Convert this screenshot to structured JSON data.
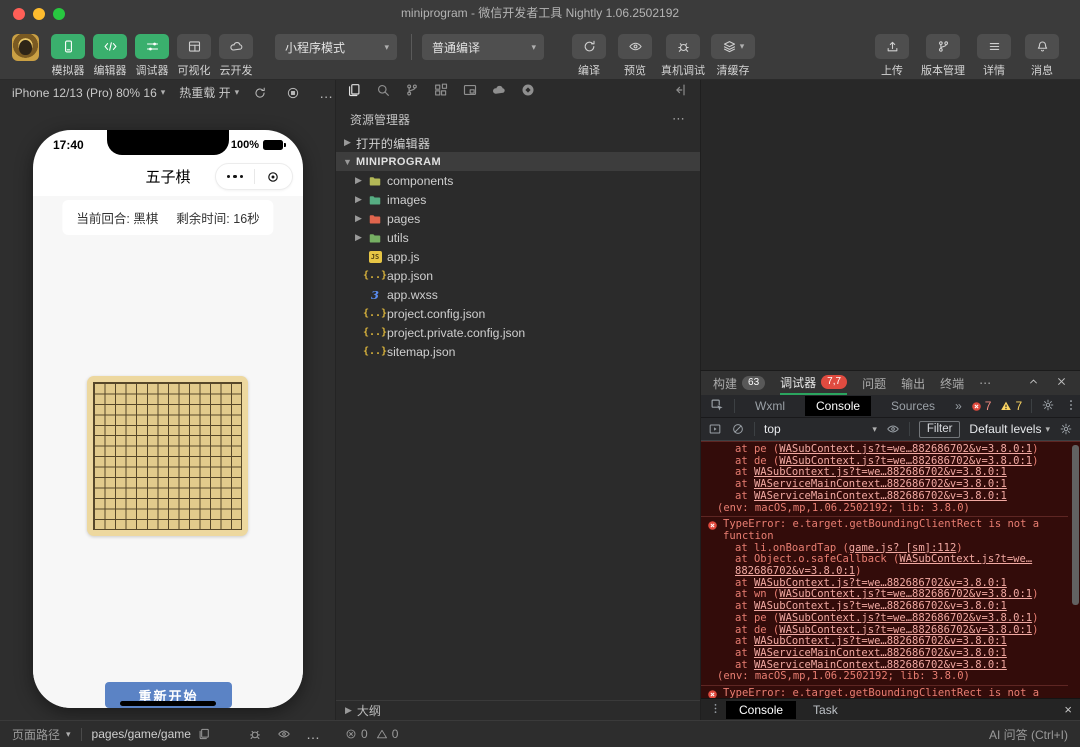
{
  "window": {
    "title": "miniprogram - 微信开发者工具 Nightly 1.06.2502192"
  },
  "toolbar": {
    "mode_dropdown": "小程序模式",
    "compile_dropdown": "普通编译",
    "mode_buttons": [
      {
        "name": "simulator",
        "label": "模拟器",
        "icon": "phone-icon",
        "active": true
      },
      {
        "name": "editor",
        "label": "编辑器",
        "icon": "code-icon",
        "active": true
      },
      {
        "name": "debugger",
        "label": "调试器",
        "icon": "sliders-icon",
        "active": true
      },
      {
        "name": "visualize",
        "label": "可视化",
        "icon": "layout-icon",
        "active": false
      },
      {
        "name": "cloud-dev",
        "label": "云开发",
        "icon": "cloud-icon",
        "active": false
      }
    ],
    "action_buttons": [
      {
        "name": "compile",
        "label": "编译",
        "icon": "refresh-icon"
      },
      {
        "name": "preview",
        "label": "预览",
        "icon": "eye-icon"
      },
      {
        "name": "device-debug",
        "label": "真机调试",
        "icon": "bug-icon"
      },
      {
        "name": "clear-cache",
        "label": "清缓存",
        "icon": "layers-icon",
        "caret": true
      }
    ],
    "right_buttons": [
      {
        "name": "upload",
        "label": "上传",
        "icon": "upload-icon"
      },
      {
        "name": "version-control",
        "label": "版本管理",
        "icon": "branch-icon"
      },
      {
        "name": "details",
        "label": "详情",
        "icon": "list-icon"
      },
      {
        "name": "messages",
        "label": "消息",
        "icon": "bell-icon"
      }
    ]
  },
  "simulator": {
    "device_selector": "iPhone 12/13 (Pro) 80% 16",
    "hot_reload": "热重载 开",
    "page_path_label": "页面路径",
    "page_path": "pages/game/game",
    "phone": {
      "time": "17:40",
      "battery": "100%",
      "nav_title": "五子棋",
      "turn_text": "当前回合: 黑棋",
      "time_text": "剩余时间: 16秒",
      "restart_label": "重新开始"
    }
  },
  "explorer": {
    "header": "资源管理器",
    "outline_label": "大纲",
    "tree": [
      {
        "name": "open-editors",
        "label": "打开的编辑器",
        "kind": "section",
        "expanded": false
      },
      {
        "name": "miniprogram-root",
        "label": "MINIPROGRAM",
        "kind": "section",
        "expanded": true,
        "selected": true
      },
      {
        "name": "components",
        "label": "components",
        "kind": "folder",
        "color": "#b3b857"
      },
      {
        "name": "images",
        "label": "images",
        "kind": "folder",
        "color": "#56ad82"
      },
      {
        "name": "pages",
        "label": "pages",
        "kind": "folder",
        "color": "#e0654d"
      },
      {
        "name": "utils",
        "label": "utils",
        "kind": "folder",
        "color": "#76b063"
      },
      {
        "name": "app-js",
        "label": "app.js",
        "kind": "js"
      },
      {
        "name": "app-json",
        "label": "app.json",
        "kind": "json"
      },
      {
        "name": "app-wxss",
        "label": "app.wxss",
        "kind": "wxss"
      },
      {
        "name": "project-config-json",
        "label": "project.config.json",
        "kind": "json"
      },
      {
        "name": "project-private-config-json",
        "label": "project.private.config.json",
        "kind": "json"
      },
      {
        "name": "sitemap-json",
        "label": "sitemap.json",
        "kind": "json"
      }
    ]
  },
  "debugger": {
    "section_tabs": [
      {
        "name": "build",
        "label": "构建",
        "badge": "63",
        "badge_color": "gray"
      },
      {
        "name": "debugger",
        "label": "调试器",
        "badge": "7,7",
        "badge_color": "red",
        "active": true
      },
      {
        "name": "problems",
        "label": "问题"
      },
      {
        "name": "output",
        "label": "输出"
      },
      {
        "name": "terminal",
        "label": "终端"
      }
    ],
    "devtools_tabs": [
      {
        "name": "wxml",
        "label": "Wxml"
      },
      {
        "name": "console",
        "label": "Console",
        "active": true
      },
      {
        "name": "sources",
        "label": "Sources"
      }
    ],
    "error_count": "7",
    "warning_count": "7",
    "console_toolbar": {
      "context": "top",
      "filter_label": "Filter",
      "levels": "Default levels"
    },
    "drawer_tabs": [
      {
        "name": "console",
        "label": "Console",
        "active": true
      },
      {
        "name": "task",
        "label": "Task"
      }
    ],
    "console_entries": [
      {
        "lines": [
          {
            "pad": 34,
            "parts": [
              {
                "text": "at pe ("
              },
              {
                "link": "WASubContext.js?t=we…882686702&v=3.8.0:1"
              },
              {
                "text": ")"
              }
            ]
          },
          {
            "pad": 34,
            "parts": [
              {
                "text": "at de ("
              },
              {
                "link": "WASubContext.js?t=we…882686702&v=3.8.0:1"
              },
              {
                "text": ")"
              }
            ]
          },
          {
            "pad": 34,
            "parts": [
              {
                "text": "at "
              },
              {
                "link": "WASubContext.js?t=we…882686702&v=3.8.0:1"
              }
            ]
          },
          {
            "pad": 34,
            "parts": [
              {
                "text": "at "
              },
              {
                "link": "WAServiceMainContext…882686702&v=3.8.0:1"
              }
            ]
          },
          {
            "pad": 34,
            "parts": [
              {
                "text": "at "
              },
              {
                "link": "WAServiceMainContext…882686702&v=3.8.0:1"
              }
            ]
          },
          {
            "pad": 16,
            "parts": [
              {
                "text": "(env: macOS,mp,1.06.2502192; lib: 3.8.0)"
              }
            ]
          }
        ]
      },
      {
        "error": true,
        "message": "TypeError: e.target.getBoundingClientRect is not a function",
        "lines": [
          {
            "pad": 34,
            "parts": [
              {
                "text": "at li.onBoardTap ("
              },
              {
                "link": "game.js? [sm]:112"
              },
              {
                "text": ")"
              }
            ]
          },
          {
            "pad": 34,
            "parts": [
              {
                "text": "at Object.o.safeCallback ("
              },
              {
                "link": "WASubContext.js?t=we…882686702&v=3.8.0:1"
              },
              {
                "text": ")"
              }
            ]
          },
          {
            "pad": 34,
            "parts": [
              {
                "text": "at "
              },
              {
                "link": "WASubContext.js?t=we…882686702&v=3.8.0:1"
              }
            ]
          },
          {
            "pad": 34,
            "parts": [
              {
                "text": "at wn ("
              },
              {
                "link": "WASubContext.js?t=we…882686702&v=3.8.0:1"
              },
              {
                "text": ")"
              }
            ]
          },
          {
            "pad": 34,
            "parts": [
              {
                "text": "at "
              },
              {
                "link": "WASubContext.js?t=we…882686702&v=3.8.0:1"
              }
            ]
          },
          {
            "pad": 34,
            "parts": [
              {
                "text": "at pe ("
              },
              {
                "link": "WASubContext.js?t=we…882686702&v=3.8.0:1"
              },
              {
                "text": ")"
              }
            ]
          },
          {
            "pad": 34,
            "parts": [
              {
                "text": "at de ("
              },
              {
                "link": "WASubContext.js?t=we…882686702&v=3.8.0:1"
              },
              {
                "text": ")"
              }
            ]
          },
          {
            "pad": 34,
            "parts": [
              {
                "text": "at "
              },
              {
                "link": "WASubContext.js?t=we…882686702&v=3.8.0:1"
              }
            ]
          },
          {
            "pad": 34,
            "parts": [
              {
                "text": "at "
              },
              {
                "link": "WAServiceMainContext…882686702&v=3.8.0:1"
              }
            ]
          },
          {
            "pad": 34,
            "parts": [
              {
                "text": "at "
              },
              {
                "link": "WAServiceMainContext…882686702&v=3.8.0:1"
              }
            ]
          },
          {
            "pad": 16,
            "parts": [
              {
                "text": "(env: macOS,mp,1.06.2502192; lib: 3.8.0)"
              }
            ]
          }
        ]
      },
      {
        "error": true,
        "message": "TypeError: e.target.getBoundingClientRect is not a function",
        "lines": []
      }
    ]
  },
  "statusbar": {
    "errors": "0",
    "warnings": "0",
    "ai_label": "AI 问答 (Ctrl+I)"
  }
}
